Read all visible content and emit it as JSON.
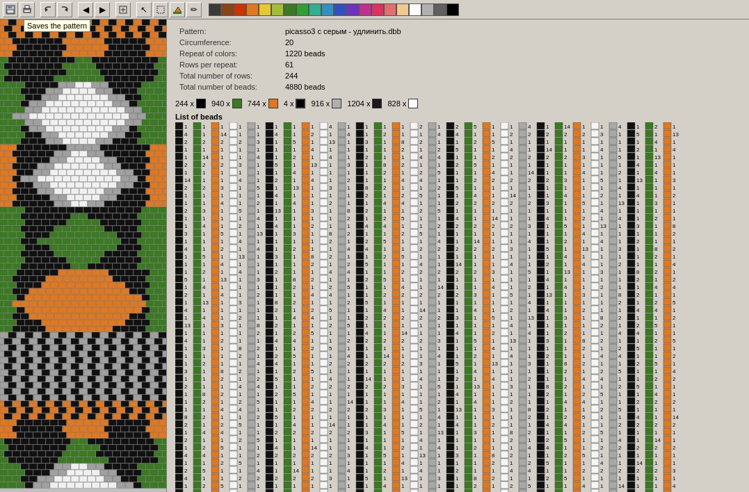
{
  "toolbar": {
    "tooltip": "Saves the pattern",
    "buttons": [
      "save",
      "print",
      "undo",
      "redo",
      "prev",
      "next",
      "new",
      "select",
      "rect-select",
      "fill",
      "draw"
    ],
    "save_label": "💾",
    "print_label": "🖨",
    "undo_label": "↩",
    "redo_label": "↪",
    "prev_label": "◀",
    "next_label": "▶",
    "new_label": "📄",
    "select_label": "↖",
    "rect_label": "▭",
    "fill_label": "⬡",
    "draw_label": "✏"
  },
  "palette": {
    "colors": [
      "#3a3a3a",
      "#6b4226",
      "#c8401e",
      "#e07820",
      "#e8c840",
      "#a8c840",
      "#408020",
      "#40a040",
      "#40c0a0",
      "#40a0c8",
      "#4060c8",
      "#8040c8",
      "#c040a0",
      "#e04080",
      "#e08080",
      "#f0d0a0",
      "#ffffff",
      "#c0c0c0",
      "#808080",
      "#000000",
      "#ff8800",
      "#008000"
    ]
  },
  "info": {
    "pattern_label": "Pattern:",
    "pattern_value": "picasso3 с серым - удлинить.dbb",
    "circumference_label": "Circumference:",
    "circumference_value": "20",
    "repeat_label": "Repeat of colors:",
    "repeat_value": "1220 beads",
    "rows_per_label": "Rows per repeat:",
    "rows_per_value": "61",
    "total_rows_label": "Total number of rows:",
    "total_rows_value": "244",
    "total_beads_label": "Total number of beads:",
    "total_beads_value": "4880 beads"
  },
  "bead_counts": [
    {
      "count": "244",
      "color": "#000000",
      "label": "x"
    },
    {
      "count": "940",
      "color": "#408020",
      "label": "x"
    },
    {
      "count": "744",
      "color": "#e07820",
      "label": "x"
    },
    {
      "count": "4",
      "color": "#000000",
      "label": "x"
    },
    {
      "count": "916",
      "color": "#c0c0c0",
      "label": "x"
    },
    {
      "count": "1204",
      "color": "#222222",
      "label": "x"
    },
    {
      "count": "828",
      "color": "#ffffff",
      "label": "x"
    }
  ],
  "list_label": "List of beads",
  "colors": {
    "black": "#000000",
    "green": "#3a7a20",
    "orange": "#e07820",
    "white": "#ffffff",
    "gray": "#a0a0a0",
    "darkgray": "#606060"
  }
}
